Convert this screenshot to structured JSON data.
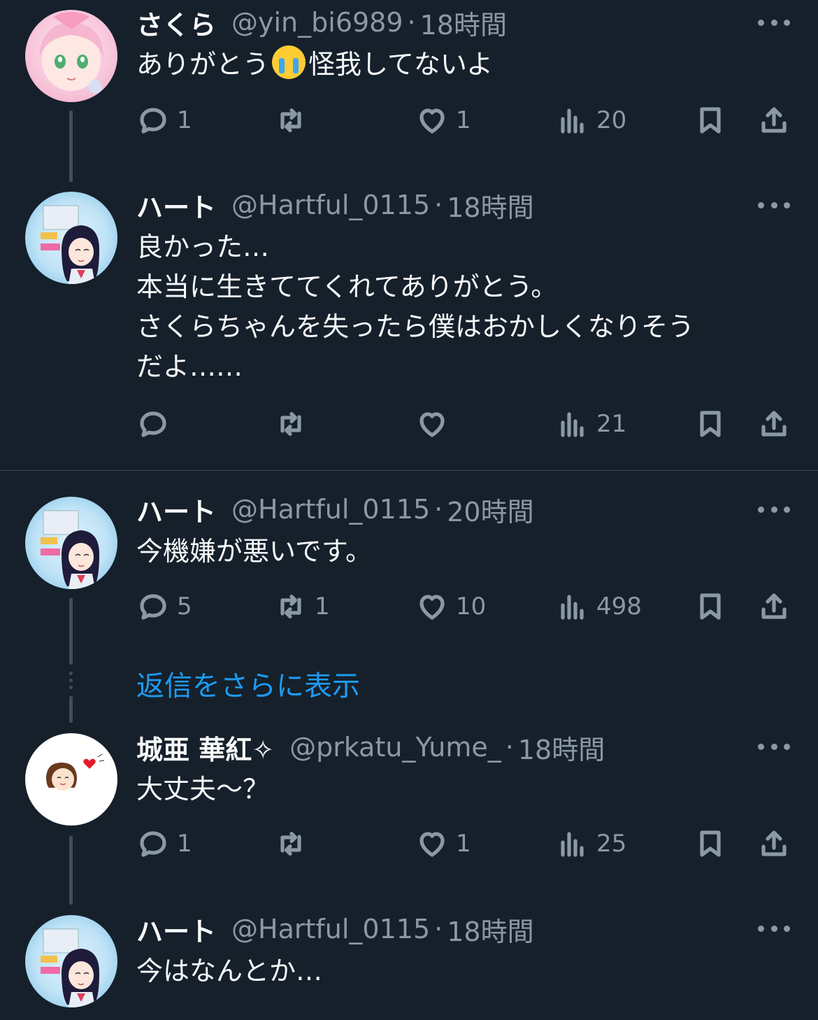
{
  "tweets": [
    {
      "name": "さくら",
      "handle": "@yin_bi6989",
      "time": "18時間",
      "text_before_emoji": "ありがとう",
      "emoji": "loudly-crying-face",
      "text_after_emoji": "怪我してないよ",
      "reply_count": "1",
      "retweet_count": "",
      "like_count": "1",
      "view_count": "20"
    },
    {
      "name": "ハート",
      "handle": "@Hartful_0115",
      "time": "18時間",
      "text": "良かった…\n本当に生きててくれてありがとう。\nさくらちゃんを失ったら僕はおかしくなりそう\nだよ……",
      "reply_count": "",
      "retweet_count": "",
      "like_count": "",
      "view_count": "21"
    },
    {
      "name": "ハート",
      "handle": "@Hartful_0115",
      "time": "20時間",
      "text": "今機嫌が悪いです。",
      "reply_count": "5",
      "retweet_count": "1",
      "like_count": "10",
      "view_count": "498"
    },
    {
      "name": "城亜 華紅✧",
      "handle": "@prkatu_Yume_",
      "time": "18時間",
      "text": "大丈夫〜？",
      "reply_count": "1",
      "retweet_count": "",
      "like_count": "1",
      "view_count": "25"
    },
    {
      "name": "ハート",
      "handle": "@Hartful_0115",
      "time": "18時間",
      "text": "今はなんとか…"
    }
  ],
  "show_more_replies": "返信をさらに表示",
  "separator": "·",
  "colors": {
    "background": "#15202b",
    "text": "#f7f9f9",
    "muted": "#8b98a5",
    "link": "#1d9bf0",
    "divider": "#38444d"
  }
}
